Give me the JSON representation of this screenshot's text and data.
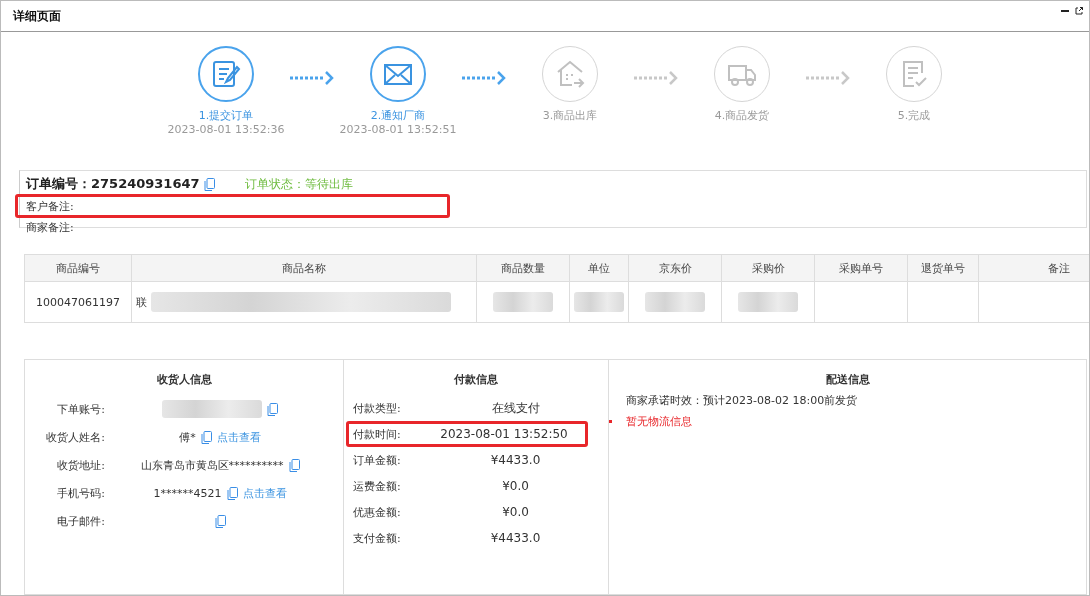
{
  "window": {
    "title": "详细页面"
  },
  "steps": [
    {
      "label": "1.提交订单",
      "time": "2023-08-01 13:52:36",
      "done": true,
      "kind": "edit"
    },
    {
      "label": "2.通知厂商",
      "time": "2023-08-01 13:52:51",
      "done": true,
      "kind": "mail"
    },
    {
      "label": "3.商品出库",
      "done": false,
      "kind": "warehouse"
    },
    {
      "label": "4.商品发货",
      "done": false,
      "kind": "truck"
    },
    {
      "label": "5.完成",
      "done": false,
      "kind": "check"
    }
  ],
  "order": {
    "number_label": "订单编号：",
    "number": "275240931647",
    "status": "订单状态：等待出库",
    "remarks": [
      {
        "label": "客户备注:",
        "highlighted": true
      },
      {
        "label": "商家备注:",
        "highlighted": false
      }
    ]
  },
  "table": {
    "columns": [
      "商品编号",
      "商品名称",
      "商品数量",
      "单位",
      "京东价",
      "采购价",
      "采购单号",
      "退货单号",
      "备注"
    ],
    "rows": [
      [
        {
          "text": "100047061197"
        },
        {
          "text": "联",
          "blurred": true
        },
        {
          "blurred": true
        },
        {
          "blurred": true
        },
        {
          "blurred": true
        },
        {
          "blurred": true
        },
        {},
        {},
        {}
      ]
    ]
  },
  "recipient": {
    "title": "收货人信息",
    "rows": [
      {
        "label": "下单账号:",
        "blurred": true
      },
      {
        "label": "收货人姓名:",
        "value": "傅*",
        "link": "点击查看"
      },
      {
        "label": "收货地址:",
        "value": "山东青岛市黄岛区**********"
      },
      {
        "label": "手机号码:",
        "value": "1******4521",
        "link": "点击查看"
      },
      {
        "label": "电子邮件:"
      }
    ]
  },
  "payment": {
    "title": "付款信息",
    "rows": [
      {
        "label": "付款类型:",
        "value": "在线支付",
        "highlighted": false
      },
      {
        "label": "付款时间:",
        "value": "2023-08-01 13:52:50",
        "highlighted": true
      },
      {
        "label": "订单金额:",
        "value": "¥4433.0",
        "highlighted": false
      },
      {
        "label": "运费金额:",
        "value": "¥0.0",
        "highlighted": false
      },
      {
        "label": "优惠金额:",
        "value": "¥0.0",
        "highlighted": false
      },
      {
        "label": "支付金额:",
        "value": "¥4433.0",
        "highlighted": false
      }
    ]
  },
  "delivery": {
    "title": "配送信息",
    "promise": "商家承诺时效：预计2023-08-02 18:00前发货",
    "logistics": "暂无物流信息"
  }
}
